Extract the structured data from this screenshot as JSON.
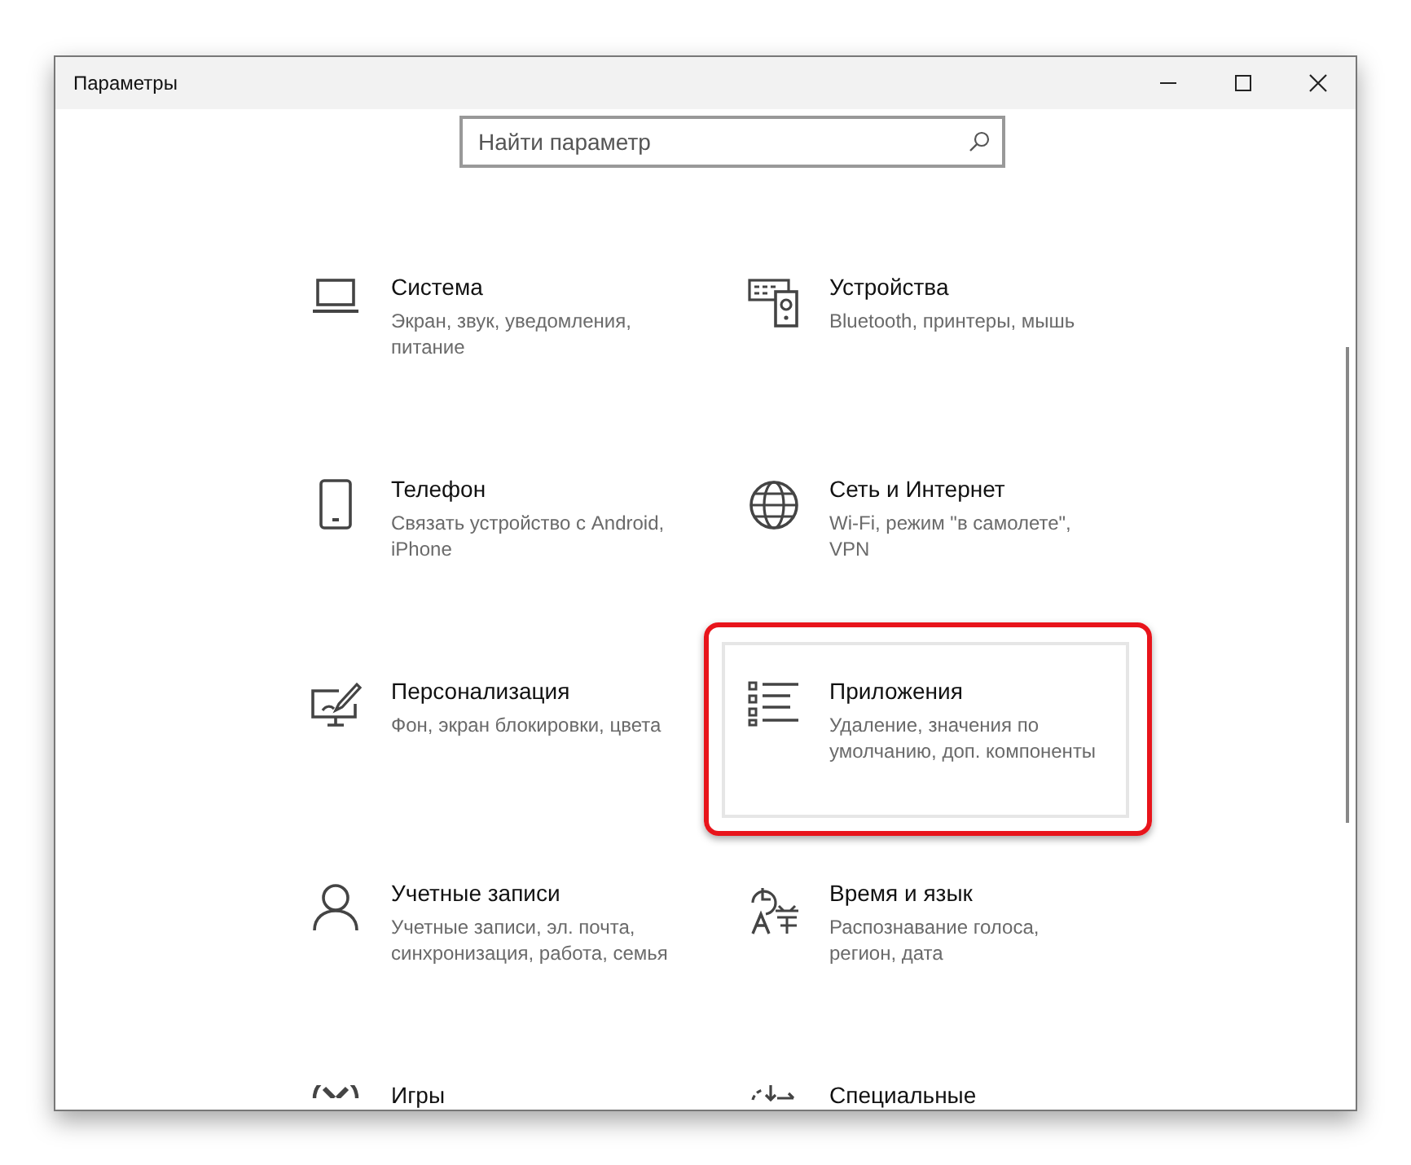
{
  "window": {
    "title": "Параметры"
  },
  "search": {
    "placeholder": "Найти параметр"
  },
  "tiles": [
    {
      "title": "Система",
      "description": "Экран, звук, уведомления, питание",
      "selected": false
    },
    {
      "title": "Устройства",
      "description": "Bluetooth, принтеры, мышь",
      "selected": false
    },
    {
      "title": "Телефон",
      "description": "Связать устройство с Android, iPhone",
      "selected": false
    },
    {
      "title": "Сеть и Интернет",
      "description": "Wi-Fi, режим \"в самолете\", VPN",
      "selected": false
    },
    {
      "title": "Персонализация",
      "description": "Фон, экран блокировки, цвета",
      "selected": false
    },
    {
      "title": "Приложения",
      "description": "Удаление, значения по умолчанию, доп. компоненты",
      "selected": true
    },
    {
      "title": "Учетные записи",
      "description": "Учетные записи, эл. почта, синхронизация, работа, семья",
      "selected": false
    },
    {
      "title": "Время и язык",
      "description": "Распознавание голоса, регион, дата",
      "selected": false
    },
    {
      "title": "Игры",
      "selected": false
    },
    {
      "title": "Специальные",
      "selected": false
    }
  ]
}
